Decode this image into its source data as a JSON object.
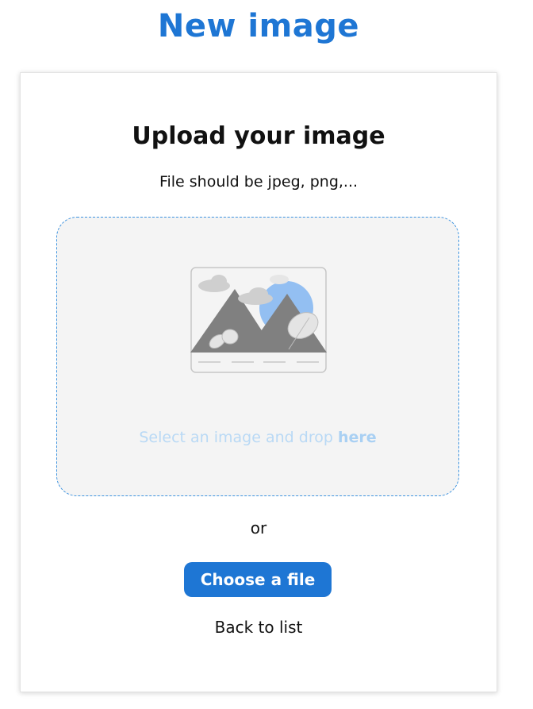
{
  "page": {
    "title": "New image"
  },
  "upload_card": {
    "heading": "Upload your image",
    "subtitle": "File should be jpeg, png,...",
    "dropzone": {
      "text_prefix": "Select an image and drop ",
      "text_emphasis": "here",
      "illustration_icon": "image-placeholder-icon"
    },
    "or_text": "or",
    "choose_button_label": "Choose a file",
    "back_link_label": "Back to list"
  },
  "colors": {
    "accent": "#1e76d4",
    "dropzone_border": "#3d93e0",
    "dropzone_bg": "#f4f4f4",
    "dropzone_text": "#b9d9f5"
  }
}
